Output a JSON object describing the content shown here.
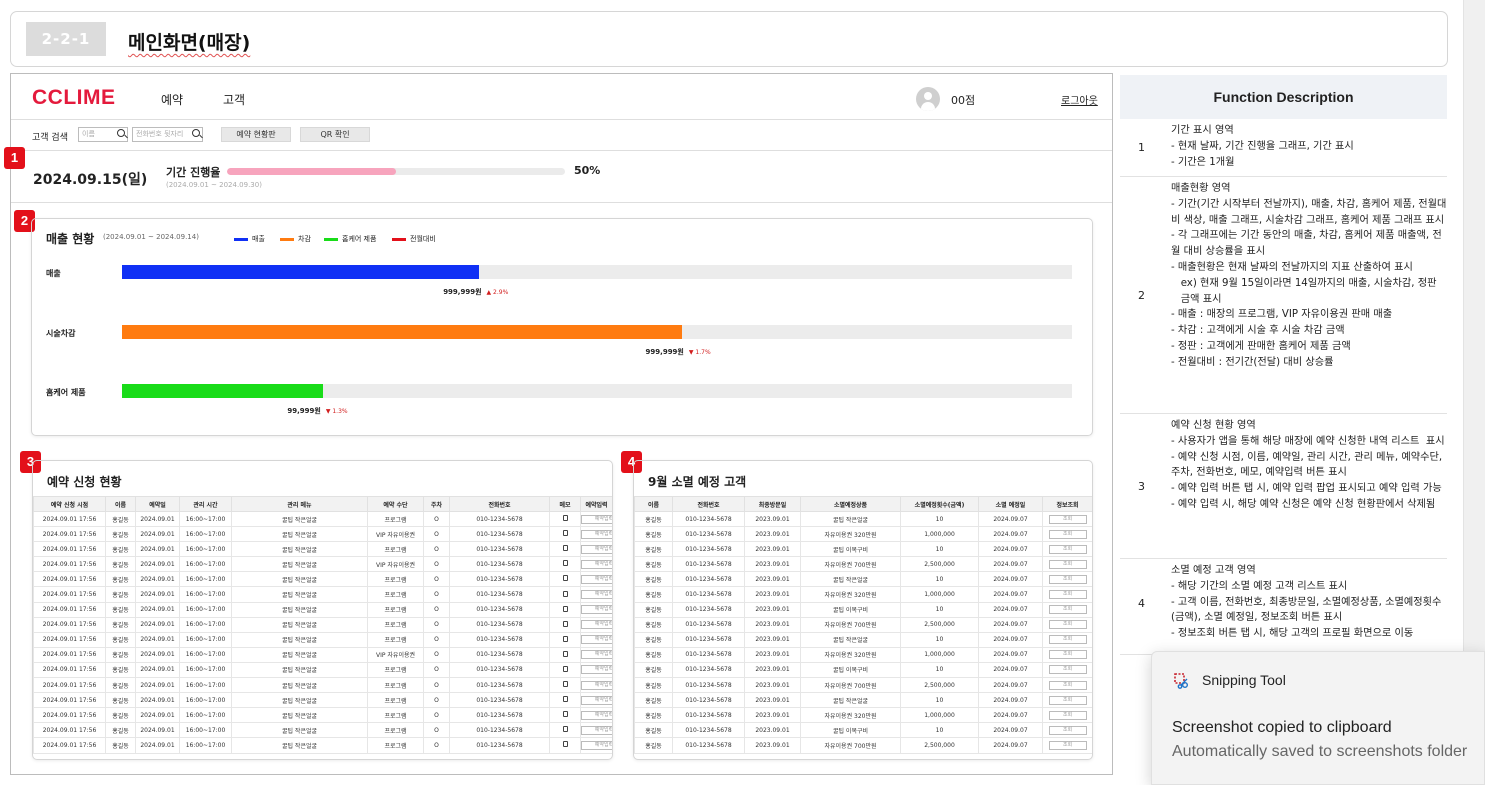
{
  "doc": {
    "code": "2-2-1",
    "title": "메인화면(매장)"
  },
  "app": {
    "logo": "CCLIME",
    "nav": [
      "예약",
      "고객"
    ],
    "user": "00점",
    "logout": "로그아웃",
    "search": {
      "label": "고객 검색",
      "name_placeholder": "이름",
      "phone_placeholder": "전화번호 뒷자리",
      "btn_reservation_board": "예약 현황판",
      "btn_qr": "QR 확인"
    },
    "badges": [
      "1",
      "2",
      "3",
      "4"
    ],
    "period": {
      "date": "2024.09.15(일)",
      "label": "기간 진행율",
      "range": "(2024.09.01 ~ 2024.09.30)",
      "progress_percent": 50,
      "progress_label": "50%",
      "fill_color": "#f7a4bd"
    },
    "sales": {
      "title": "매출 현황",
      "range": "(2024.09.01 ~ 2024.09.14)",
      "legend": [
        {
          "name": "매출",
          "color": "#1030f5"
        },
        {
          "name": "차감",
          "color": "#ff7b10"
        },
        {
          "name": "홈케어 제품",
          "color": "#19dc19"
        },
        {
          "name": "전월대비",
          "color": "#e3101a"
        }
      ],
      "rows": [
        {
          "label": "매출",
          "fraction": 0.376,
          "color": "#1030f5",
          "value": "999,999원",
          "change": "▲ 2.9%"
        },
        {
          "label": "시술차감",
          "fraction": 0.589,
          "color": "#ff7b10",
          "value": "999,999원",
          "change": "▼ 1.7%"
        },
        {
          "label": "홈케어 제품",
          "fraction": 0.212,
          "color": "#19dc19",
          "value": "99,999원",
          "change": "▼ 1.3%"
        }
      ]
    },
    "reservations": {
      "title": "예약 신청 현황",
      "columns": [
        "예약 신청 시점",
        "이름",
        "예약일",
        "관리 시간",
        "관리 메뉴",
        "예약 수단",
        "주차",
        "전화번호",
        "메모",
        "예약입력"
      ],
      "button_label": "예약입력",
      "rows": [
        [
          "2024.09.01 17:56",
          "홍길동",
          "2024.09.01",
          "16:00~17:00",
          "꿀팁 작은얼굴",
          "프로그램",
          "O",
          "010-1234-5678"
        ],
        [
          "2024.09.01 17:56",
          "홍길동",
          "2024.09.01",
          "16:00~17:00",
          "꿀팁 작은얼굴",
          "VIP 자유이용권",
          "O",
          "010-1234-5678"
        ],
        [
          "2024.09.01 17:56",
          "홍길동",
          "2024.09.01",
          "16:00~17:00",
          "꿀팁 작은얼굴",
          "프로그램",
          "O",
          "010-1234-5678"
        ],
        [
          "2024.09.01 17:56",
          "홍길동",
          "2024.09.01",
          "16:00~17:00",
          "꿀팁 작은얼굴",
          "VIP 자유이용권",
          "O",
          "010-1234-5678"
        ],
        [
          "2024.09.01 17:56",
          "홍길동",
          "2024.09.01",
          "16:00~17:00",
          "꿀팁 작은얼굴",
          "프로그램",
          "O",
          "010-1234-5678"
        ],
        [
          "2024.09.01 17:56",
          "홍길동",
          "2024.09.01",
          "16:00~17:00",
          "꿀팁 작은얼굴",
          "프로그램",
          "O",
          "010-1234-5678"
        ],
        [
          "2024.09.01 17:56",
          "홍길동",
          "2024.09.01",
          "16:00~17:00",
          "꿀팁 작은얼굴",
          "프로그램",
          "O",
          "010-1234-5678"
        ],
        [
          "2024.09.01 17:56",
          "홍길동",
          "2024.09.01",
          "16:00~17:00",
          "꿀팁 작은얼굴",
          "프로그램",
          "O",
          "010-1234-5678"
        ],
        [
          "2024.09.01 17:56",
          "홍길동",
          "2024.09.01",
          "16:00~17:00",
          "꿀팁 작은얼굴",
          "프로그램",
          "O",
          "010-1234-5678"
        ],
        [
          "2024.09.01 17:56",
          "홍길동",
          "2024.09.01",
          "16:00~17:00",
          "꿀팁 작은얼굴",
          "VIP 자유이용권",
          "O",
          "010-1234-5678"
        ],
        [
          "2024.09.01 17:56",
          "홍길동",
          "2024.09.01",
          "16:00~17:00",
          "꿀팁 작은얼굴",
          "프로그램",
          "O",
          "010-1234-5678"
        ],
        [
          "2024.09.01 17:56",
          "홍길동",
          "2024.09.01",
          "16:00~17:00",
          "꿀팁 작은얼굴",
          "프로그램",
          "O",
          "010-1234-5678"
        ],
        [
          "2024.09.01 17:56",
          "홍길동",
          "2024.09.01",
          "16:00~17:00",
          "꿀팁 작은얼굴",
          "프로그램",
          "O",
          "010-1234-5678"
        ],
        [
          "2024.09.01 17:56",
          "홍길동",
          "2024.09.01",
          "16:00~17:00",
          "꿀팁 작은얼굴",
          "프로그램",
          "O",
          "010-1234-5678"
        ],
        [
          "2024.09.01 17:56",
          "홍길동",
          "2024.09.01",
          "16:00~17:00",
          "꿀팁 작은얼굴",
          "프로그램",
          "O",
          "010-1234-5678"
        ],
        [
          "2024.09.01 17:56",
          "홍길동",
          "2024.09.01",
          "16:00~17:00",
          "꿀팁 작은얼굴",
          "프로그램",
          "O",
          "010-1234-5678"
        ]
      ]
    },
    "expiring": {
      "title": "9월 소멸 예정 고객",
      "columns": [
        "이름",
        "전화번호",
        "최종방문일",
        "소멸예정상품",
        "소멸예정횟수(금액)",
        "소멸 예정일",
        "정보조회"
      ],
      "button_label": "조회",
      "rows": [
        [
          "홍길동",
          "010-1234-5678",
          "2023.09.01",
          "꿀팁 작은얼굴",
          "10",
          "2024.09.07"
        ],
        [
          "홍길동",
          "010-1234-5678",
          "2023.09.01",
          "자유이용권 320만원",
          "1,000,000",
          "2024.09.07"
        ],
        [
          "홍길동",
          "010-1234-5678",
          "2023.09.01",
          "꿀팁 이목구비",
          "10",
          "2024.09.07"
        ],
        [
          "홍길동",
          "010-1234-5678",
          "2023.09.01",
          "자유이용권 700만원",
          "2,500,000",
          "2024.09.07"
        ],
        [
          "홍길동",
          "010-1234-5678",
          "2023.09.01",
          "꿀팁 작은얼굴",
          "10",
          "2024.09.07"
        ],
        [
          "홍길동",
          "010-1234-5678",
          "2023.09.01",
          "자유이용권 320만원",
          "1,000,000",
          "2024.09.07"
        ],
        [
          "홍길동",
          "010-1234-5678",
          "2023.09.01",
          "꿀팁 이목구비",
          "10",
          "2024.09.07"
        ],
        [
          "홍길동",
          "010-1234-5678",
          "2023.09.01",
          "자유이용권 700만원",
          "2,500,000",
          "2024.09.07"
        ],
        [
          "홍길동",
          "010-1234-5678",
          "2023.09.01",
          "꿀팁 작은얼굴",
          "10",
          "2024.09.07"
        ],
        [
          "홍길동",
          "010-1234-5678",
          "2023.09.01",
          "자유이용권 320만원",
          "1,000,000",
          "2024.09.07"
        ],
        [
          "홍길동",
          "010-1234-5678",
          "2023.09.01",
          "꿀팁 이목구비",
          "10",
          "2024.09.07"
        ],
        [
          "홍길동",
          "010-1234-5678",
          "2023.09.01",
          "자유이용권 700만원",
          "2,500,000",
          "2024.09.07"
        ],
        [
          "홍길동",
          "010-1234-5678",
          "2023.09.01",
          "꿀팁 작은얼굴",
          "10",
          "2024.09.07"
        ],
        [
          "홍길동",
          "010-1234-5678",
          "2023.09.01",
          "자유이용권 320만원",
          "1,000,000",
          "2024.09.07"
        ],
        [
          "홍길동",
          "010-1234-5678",
          "2023.09.01",
          "꿀팁 이목구비",
          "10",
          "2024.09.07"
        ],
        [
          "홍길동",
          "010-1234-5678",
          "2023.09.01",
          "자유이용권 700만원",
          "2,500,000",
          "2024.09.07"
        ]
      ]
    }
  },
  "function_description": {
    "header": "Function Description",
    "items": [
      {
        "num": "1",
        "text": "기간 표시 영역\n- 현재 날짜, 기간 진행율 그래프, 기간 표시\n- 기간은 1개월"
      },
      {
        "num": "2",
        "text": "매출현황 영역\n- 기간(기간 시작부터 전날까지), 매출, 차감, 홈케어 제품, 전월대비 색상, 매출 그래프, 시술차감 그래프, 홈케어 제품 그래프 표시\n- 각 그래프에는 기간 동안의 매출, 차감, 홈케어 제품 매출액, 전월 대비 상승률을 표시\n- 매출현황은 현재 날짜의 전날까지의 지표 산출하여 표시\n   ex) 현재 9월 15일이라면 14일까지의 매출, 시술차감, 정판\n   금액 표시\n- 매출 : 매장의 프로그램, VIP 자유이용권 판매 매출\n- 차감 : 고객에게 시술 후 시술 차감 금액\n- 정판 : 고객에게 판매한 홈케어 제품 금액\n- 전월대비 : 전기간(전달) 대비 상승률"
      },
      {
        "num": "3",
        "text": "예약 신청 현황 영역\n- 사용자가 앱을 통해 해당 매장에 예약 신청한 내역 리스트  표시\n- 예약 신청 시점, 이름, 예약일, 관리 시간, 관리 메뉴, 예약수단, 주차, 전화번호, 메모, 예약입력 버튼 표시\n- 예약 입력 버튼 탭 시, 예약 입력 팝업 표시되고 예약 입력 가능\n- 예약 입력 시, 해당 예약 신청은 예약 신청 현황판에서 삭제됨"
      },
      {
        "num": "4",
        "text": "소멸 예정 고객 영역\n- 해당 기간의 소멸 예정 고객 리스트 표시\n- 고객 이름, 전화번호, 최종방문일, 소멸예정상품, 소멸예정횟수(금액), 소멸 예정일, 정보조회 버튼 표시\n- 정보조회 버튼 탭 시, 해당 고객의 프로필 화면으로 이동"
      }
    ]
  },
  "toast": {
    "app": "Snipping Tool",
    "title": "Screenshot copied to clipboard",
    "subtitle": "Automatically saved to screenshots folder"
  }
}
